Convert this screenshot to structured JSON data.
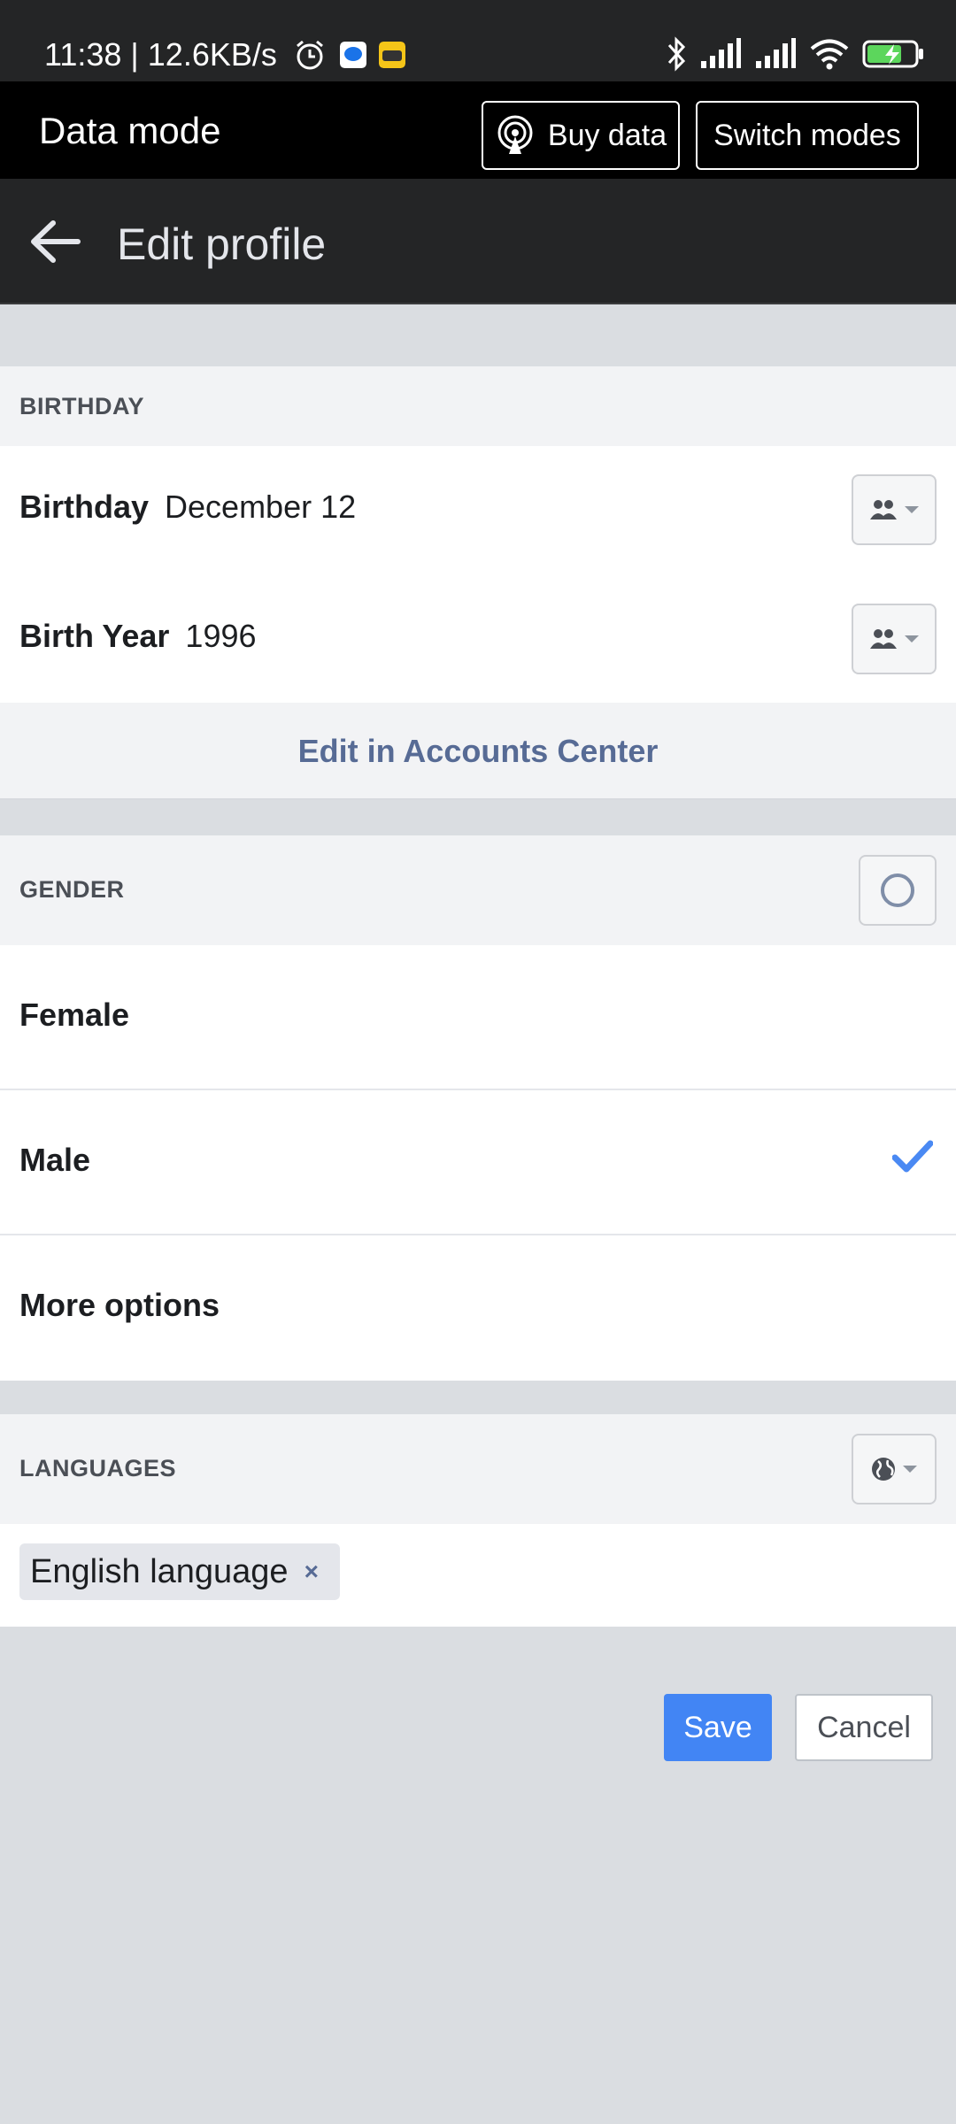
{
  "status_bar": {
    "time": "11:38 | 12.6KB/s",
    "icons_left": [
      "alarm-icon",
      "messenger-app-icon",
      "game-app-icon"
    ],
    "icons_right": [
      "bluetooth-icon",
      "signal-icon",
      "signal-icon",
      "wifi-icon",
      "battery-charging-icon"
    ]
  },
  "data_mode": {
    "title": "Data mode",
    "buy_label": "Buy data",
    "switch_label": "Switch modes"
  },
  "header": {
    "title": "Edit profile"
  },
  "birthday": {
    "section_label": "BIRTHDAY",
    "birthday_label": "Birthday",
    "birthday_value": "December 12",
    "birth_year_label": "Birth Year",
    "birth_year_value": "1996",
    "audience_icon": "friends-icon",
    "edit_link": "Edit in Accounts Center"
  },
  "gender": {
    "section_label": "GENDER",
    "options": [
      {
        "label": "Female",
        "selected": false
      },
      {
        "label": "Male",
        "selected": true
      },
      {
        "label": "More options",
        "selected": false
      }
    ]
  },
  "languages": {
    "section_label": "LANGUAGES",
    "audience_icon": "globe-icon",
    "chips": [
      {
        "label": "English language",
        "remove": "×"
      }
    ]
  },
  "actions": {
    "save_label": "Save",
    "cancel_label": "Cancel"
  },
  "colors": {
    "accent": "#4285f4",
    "link": "#576b95",
    "check": "#4a89f3",
    "dark_bar": "#242526"
  }
}
